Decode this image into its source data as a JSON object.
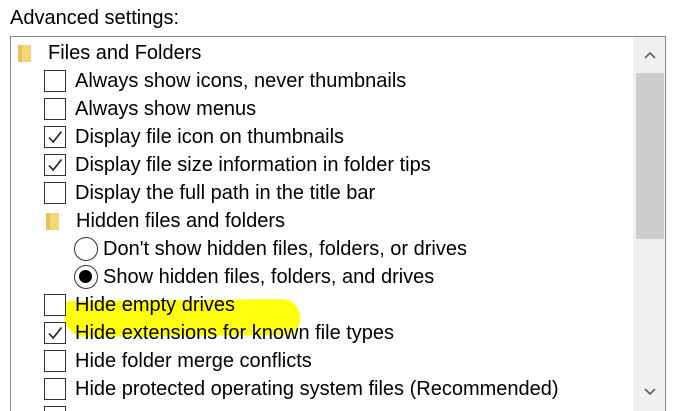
{
  "section_label": "Advanced settings:",
  "tree": {
    "items": [
      {
        "type": "folder",
        "label": "Files and Folders"
      },
      {
        "type": "checkbox",
        "label": "Always show icons, never thumbnails",
        "checked": false
      },
      {
        "type": "checkbox",
        "label": "Always show menus",
        "checked": false
      },
      {
        "type": "checkbox",
        "label": "Display file icon on thumbnails",
        "checked": true
      },
      {
        "type": "checkbox",
        "label": "Display file size information in folder tips",
        "checked": true
      },
      {
        "type": "checkbox",
        "label": "Display the full path in the title bar",
        "checked": false
      },
      {
        "type": "folder",
        "label": "Hidden files and folders"
      },
      {
        "type": "radio",
        "label": "Don't show hidden files, folders, or drives",
        "selected": false
      },
      {
        "type": "radio",
        "label": "Show hidden files, folders, and drives",
        "selected": true
      },
      {
        "type": "checkbox",
        "label": "Hide empty drives",
        "checked": false
      },
      {
        "type": "checkbox",
        "label": "Hide extensions for known file types",
        "checked": true
      },
      {
        "type": "checkbox",
        "label": "Hide folder merge conflicts",
        "checked": false
      },
      {
        "type": "checkbox",
        "label": "Hide protected operating system files (Recommended)",
        "checked": false
      }
    ]
  },
  "scrollbar": {
    "up_icon": "chevron-up-icon",
    "down_icon": "chevron-down-icon"
  },
  "colors": {
    "highlight": "#ffff00",
    "folder": "#f5d778",
    "border": "#828790",
    "scroll_track": "#f0f0f0",
    "scroll_thumb": "#cdcdcd"
  }
}
